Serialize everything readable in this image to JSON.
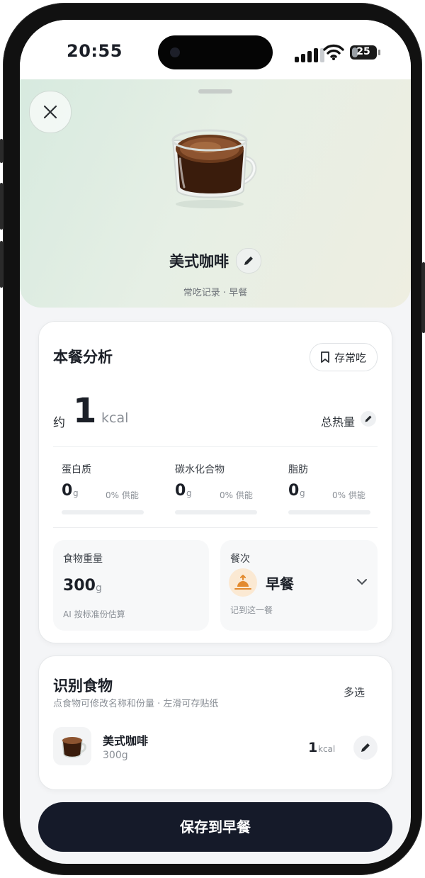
{
  "status": {
    "time": "20:55",
    "battery": "25",
    "battery_level": 0.25
  },
  "hero": {
    "dish_name": "美式咖啡",
    "subtitle": "常吃记录 · 早餐",
    "icons": {
      "close": "close-icon",
      "edit": "pencil-icon",
      "food": "coffee-cup-image"
    }
  },
  "analysis": {
    "title": "本餐分析",
    "save_frequent": "存常吃",
    "approx_prefix": "约",
    "calories": "1",
    "calorie_unit": "kcal",
    "total_label": "总热量",
    "macros": [
      {
        "name": "蛋白质",
        "value": "0",
        "unit": "g",
        "supply": "0% 供能",
        "progress": 0
      },
      {
        "name": "碳水化合物",
        "value": "0",
        "unit": "g",
        "supply": "0% 供能",
        "progress": 0
      },
      {
        "name": "脂肪",
        "value": "0",
        "unit": "g",
        "supply": "0% 供能",
        "progress": 0
      }
    ],
    "weight": {
      "label": "食物重量",
      "value": "300",
      "unit": "g",
      "note": "AI 按标准份估算"
    },
    "meal": {
      "label": "餐次",
      "value": "早餐",
      "note": "记到这一餐",
      "icon": "sunrise-icon"
    }
  },
  "recognized": {
    "title": "识别食物",
    "multi_select": "多选",
    "hint": "点食物可修改名称和份量 · 左滑可存贴纸",
    "items": [
      {
        "name": "美式咖啡",
        "weight": "300g",
        "calories": "1",
        "unit": "kcal"
      }
    ]
  },
  "save_button": "保存到早餐",
  "colors": {
    "primary_button": "#151a29",
    "hero_start": "#d7eadf",
    "hero_end": "#eeeee1",
    "meal_icon_bg": "#fbe9d3",
    "meal_icon": "#e38a2e"
  }
}
